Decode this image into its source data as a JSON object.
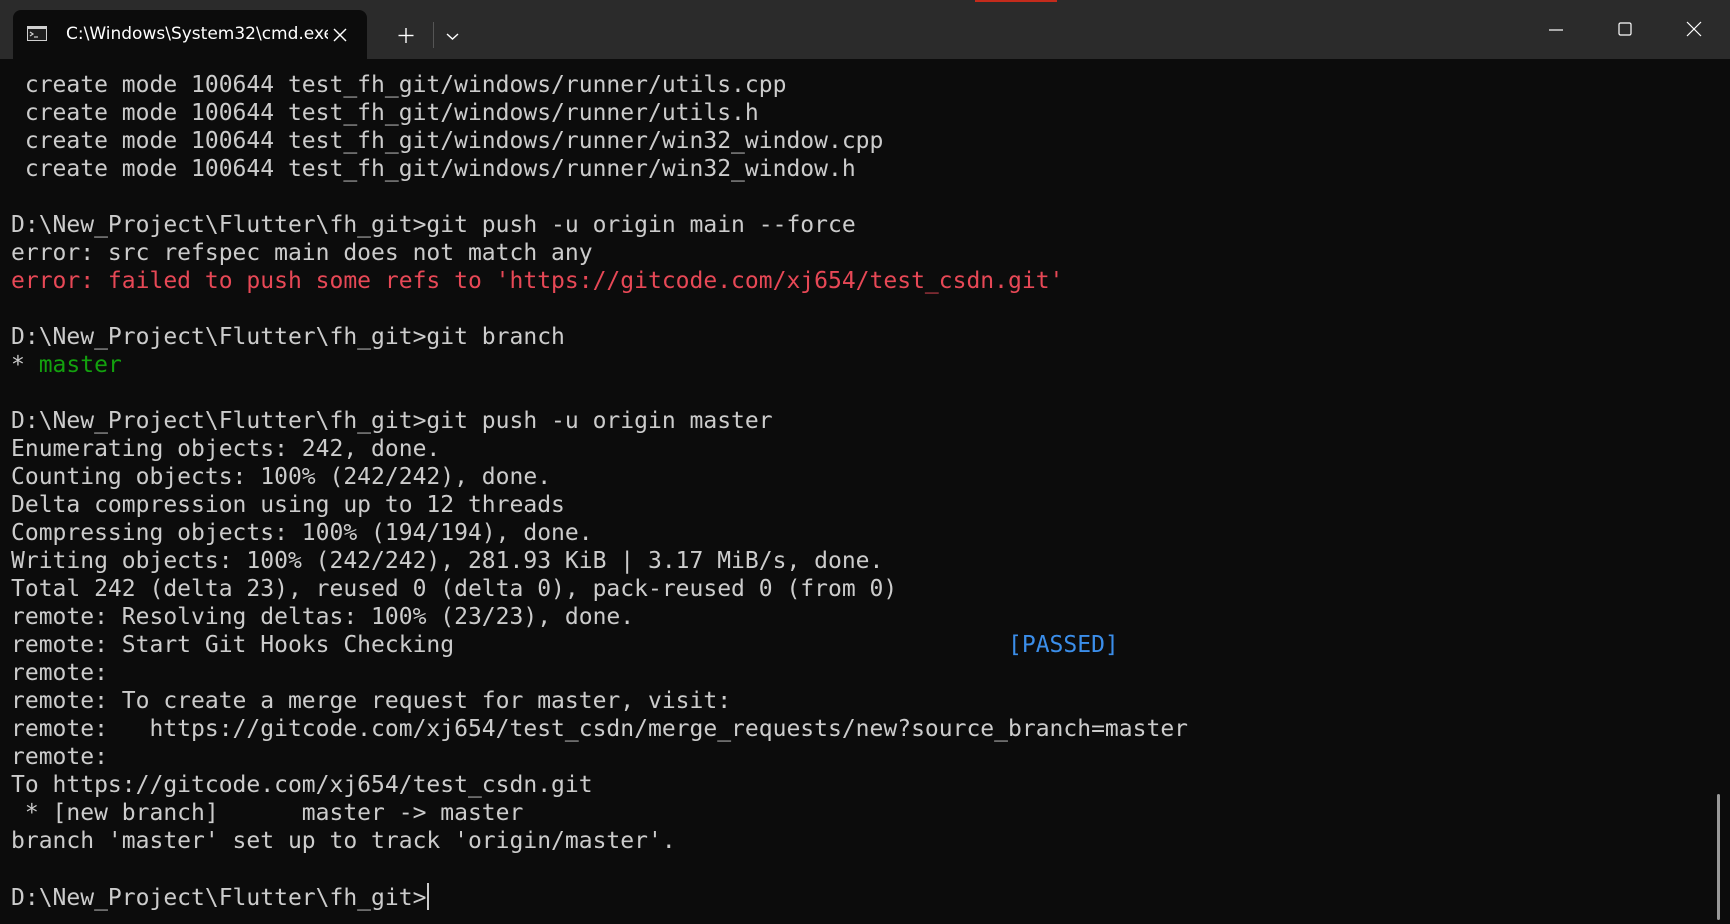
{
  "window": {
    "tab_title": "C:\\Windows\\System32\\cmd.exe",
    "tab_icon": "terminal-icon",
    "controls": [
      "minimize-icon",
      "maximize-icon",
      "close-icon"
    ]
  },
  "colors": {
    "background": "#0c0c0c",
    "titlebar": "#2b2b2b",
    "text": "#cccccc",
    "error": "#e74856",
    "branch": "#13a10e",
    "passed": "#3b8eea"
  },
  "terminal": {
    "lines": [
      " create mode 100644 test_fh_git/windows/runner/utils.cpp",
      " create mode 100644 test_fh_git/windows/runner/utils.h",
      " create mode 100644 test_fh_git/windows/runner/win32_window.cpp",
      " create mode 100644 test_fh_git/windows/runner/win32_window.h",
      "",
      "D:\\New_Project\\Flutter\\fh_git>git push -u origin main --force",
      "error: src refspec main does not match any",
      "error: failed to push some refs to 'https://gitcode.com/xj654/test_csdn.git'",
      "",
      "D:\\New_Project\\Flutter\\fh_git>git branch",
      "* ",
      "master",
      "",
      "D:\\New_Project\\Flutter\\fh_git>git push -u origin master",
      "Enumerating objects: 242, done.",
      "Counting objects: 100% (242/242), done.",
      "Delta compression using up to 12 threads",
      "Compressing objects: 100% (194/194), done.",
      "Writing objects: 100% (242/242), 281.93 KiB | 3.17 MiB/s, done.",
      "Total 242 (delta 23), reused 0 (delta 0), pack-reused 0 (from 0)",
      "remote: Resolving deltas: 100% (23/23), done.",
      "remote: Start Git Hooks Checking                                        ",
      "[PASSED]",
      "remote:",
      "remote: To create a merge request for master, visit:",
      "remote:   https://gitcode.com/xj654/test_csdn/merge_requests/new?source_branch=master",
      "remote:",
      "To https://gitcode.com/xj654/test_csdn.git",
      " * [new branch]      master -> master",
      "branch 'master' set up to track 'origin/master'.",
      "",
      "D:\\New_Project\\Flutter\\fh_git>"
    ]
  }
}
